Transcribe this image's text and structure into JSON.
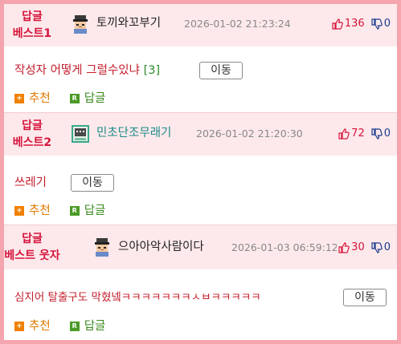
{
  "posts": [
    {
      "badge_line1": "답글",
      "badge_line2": "베스트1",
      "nickname": "토끼와꼬부기",
      "date": "2026-01-02 21:23:24",
      "likes": "136",
      "dislikes": "0",
      "title": "작성자 어떻게 그럴수있냐",
      "comment_count": "[3]",
      "move_label": "이동",
      "recommend_label": "추천",
      "reply_label": "답글",
      "recommend_icon": "+",
      "reply_icon": "R"
    },
    {
      "badge_line1": "답글",
      "badge_line2": "베스트2",
      "nickname": "민초단조무래기",
      "date": "2026-01-02 21:20:30",
      "likes": "72",
      "dislikes": "0",
      "title": "쓰레기",
      "comment_count": "",
      "move_label": "이동",
      "recommend_label": "추천",
      "reply_label": "답글",
      "recommend_icon": "+",
      "reply_icon": "R"
    },
    {
      "badge_line1": "답글",
      "badge_line2": "베스트 웃자",
      "nickname": "으아아악사람이다",
      "date": "2026-01-03 06:59:12",
      "likes": "30",
      "dislikes": "0",
      "title": "심지어 탈출구도 막혔넼ㅋㅋㅋㅋㅋㅋㅋㅅㅂㅋㅋㅋㅋㅋ",
      "comment_count": "",
      "move_label": "이동",
      "recommend_label": "추천",
      "reply_label": "답글",
      "recommend_icon": "+",
      "reply_icon": "R"
    }
  ],
  "colors": {
    "border": "#f4a5ad",
    "header_bg": "#fde9eb",
    "badge": "#d6143c",
    "title": "#c41e2c",
    "comment_count": "#2d8c2d",
    "nick_teal": "#1a8a8a",
    "like": "#d6143c",
    "dislike": "#1a3a8c",
    "recommend": "#e07800",
    "reply": "#3a8a1e"
  }
}
